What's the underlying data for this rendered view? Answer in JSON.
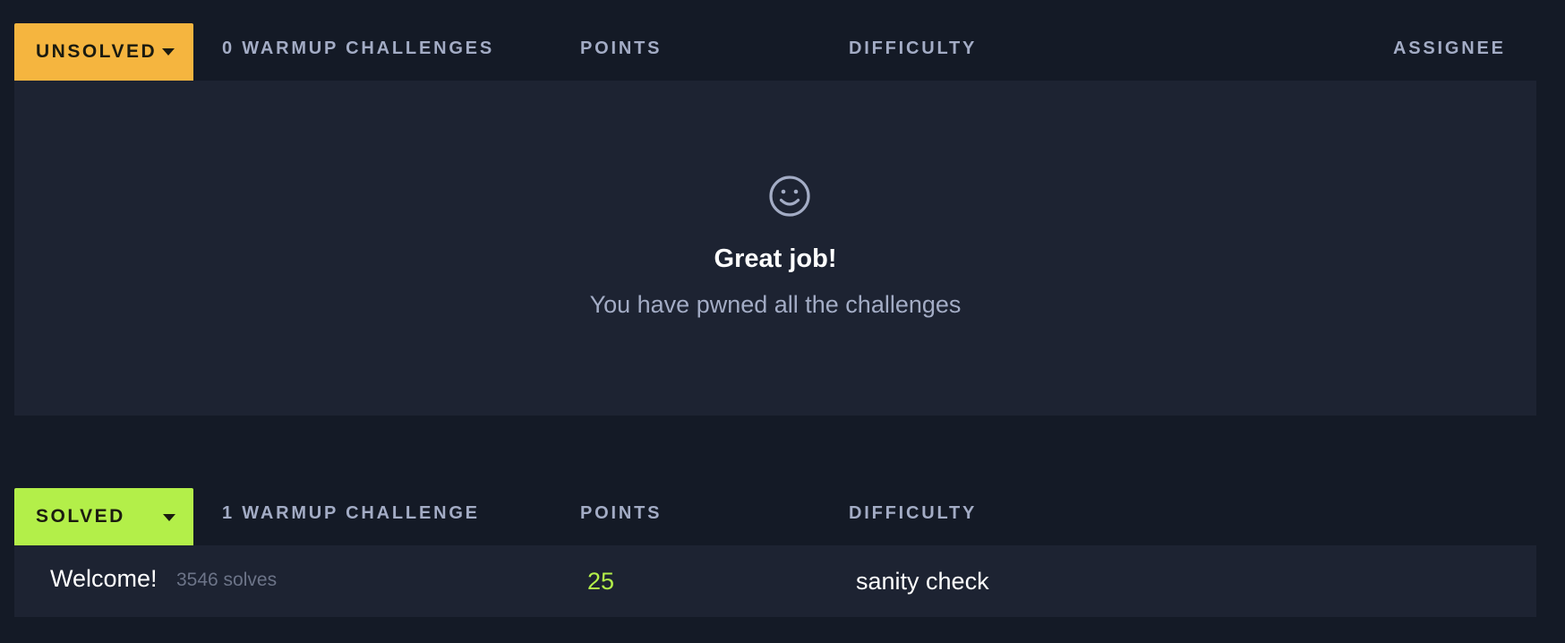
{
  "colors": {
    "background": "#141a26",
    "panel": "#1d2332",
    "unsolved_accent": "#f5b53f",
    "solved_accent": "#b3ef49",
    "muted_text": "#a3acc5"
  },
  "unsolved_section": {
    "status_label": "UNSOLVED",
    "count_label": "0 WARMUP CHALLENGES",
    "points_label": "POINTS",
    "difficulty_label": "DIFFICULTY",
    "assignee_label": "ASSIGNEE",
    "empty_state": {
      "icon": "smile-icon",
      "title": "Great job!",
      "message": "You have pwned all the challenges"
    }
  },
  "solved_section": {
    "status_label": "SOLVED",
    "count_label": "1 WARMUP CHALLENGE",
    "points_label": "POINTS",
    "difficulty_label": "DIFFICULTY",
    "challenges": [
      {
        "name": "Welcome!",
        "solves": "3546 solves",
        "points": "25",
        "difficulty": "sanity check"
      }
    ]
  }
}
